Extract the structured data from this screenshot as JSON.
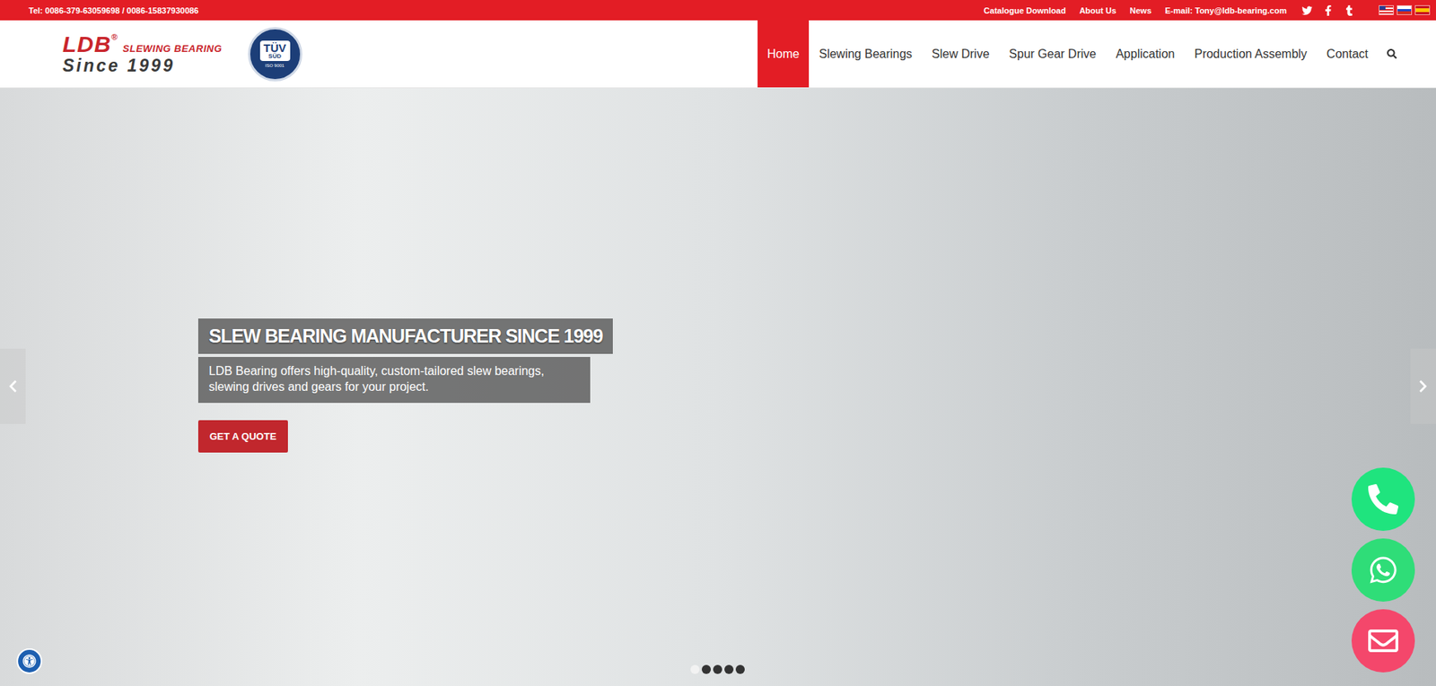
{
  "topbar": {
    "phone": "Tel: 0086-379-63059698 / 0086-15837930086",
    "links": [
      "Catalogue Download",
      "About Us",
      "News",
      "E-mail: Tony@ldb-bearing.com"
    ],
    "social": [
      {
        "kind": "twitter"
      },
      {
        "kind": "facebook"
      },
      {
        "kind": "tumblr"
      }
    ],
    "flags": [
      {
        "kind": "us"
      },
      {
        "kind": "ru"
      },
      {
        "kind": "es"
      }
    ]
  },
  "logo": {
    "brand": "LDB",
    "mark": "®",
    "tagline": "SLEWING BEARING",
    "since": "Since 1999"
  },
  "certification": {
    "top": "TÜV",
    "bottom": "SÜD",
    "code": "ISO 9001"
  },
  "nav": [
    {
      "label": "Home",
      "selected": true
    },
    {
      "label": "Slewing Bearings",
      "selected": false
    },
    {
      "label": "Slew Drive",
      "selected": false
    },
    {
      "label": "Spur Gear Drive",
      "selected": false
    },
    {
      "label": "Application",
      "selected": false
    },
    {
      "label": "Production Assembly",
      "selected": false
    },
    {
      "label": "Contact",
      "selected": false
    }
  ],
  "hero": {
    "title": "SLEW BEARING MANUFACTURER SINCE 1999",
    "text": "LDB Bearing offers high-quality, custom-tailored slew bearings, slewing drives and gears for your project.",
    "button": "GET A QUOTE",
    "slides": [
      {
        "selected": true
      },
      {
        "selected": false
      },
      {
        "selected": false
      },
      {
        "selected": false
      },
      {
        "selected": false
      }
    ]
  },
  "contact_buttons": [
    {
      "kind": "phone",
      "color": "#1fe47e"
    },
    {
      "kind": "whatsapp",
      "color": "#2fdd78"
    },
    {
      "kind": "email",
      "color": "#f4476b"
    }
  ]
}
